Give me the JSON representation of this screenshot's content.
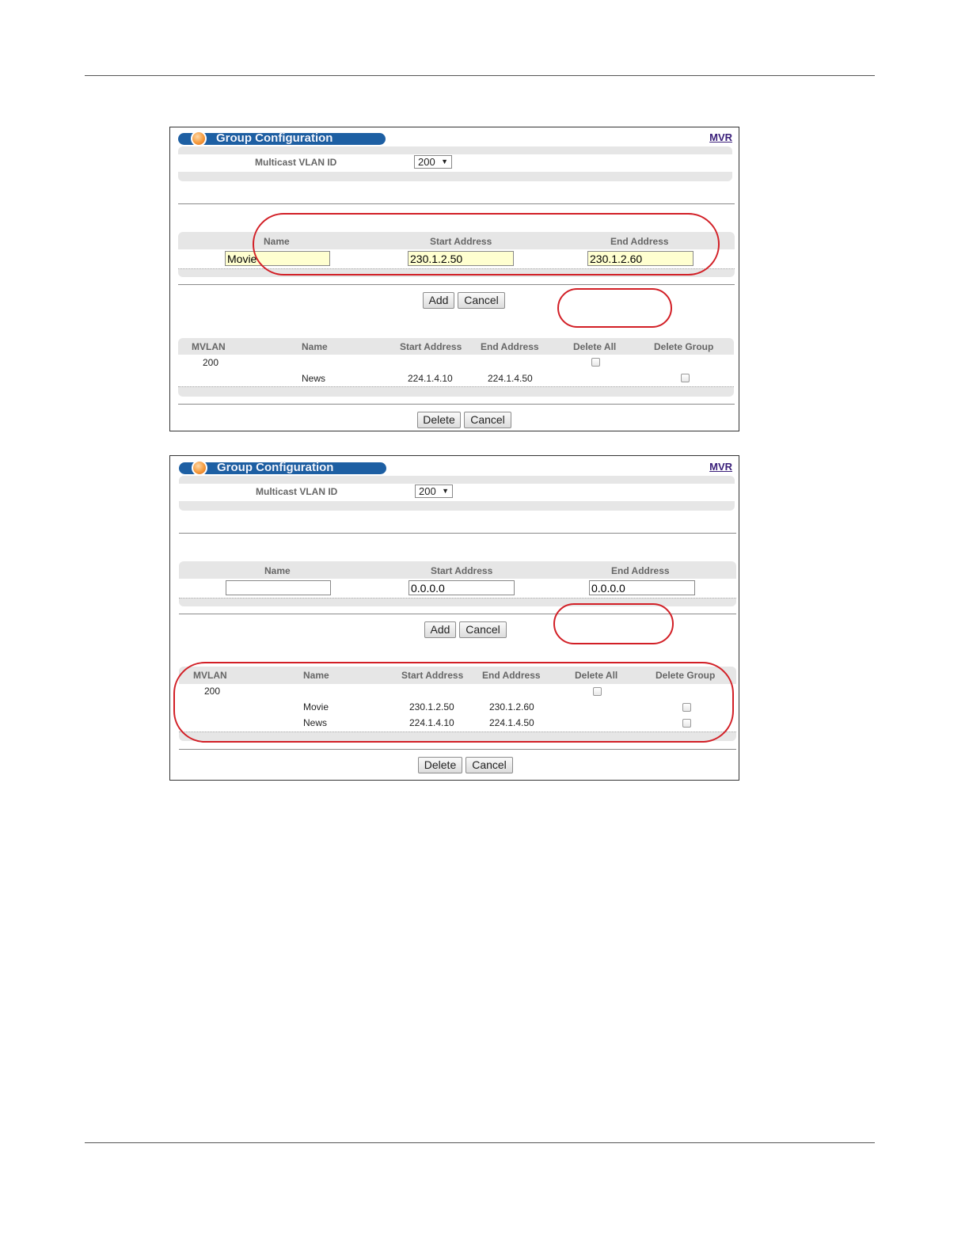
{
  "panels": [
    {
      "title": "Group Configuration",
      "link": "MVR",
      "vlan_label": "Multicast VLAN ID",
      "vlan_value": "200",
      "form_headers": {
        "name": "Name",
        "start": "Start Address",
        "end": "End Address"
      },
      "form_values": {
        "name": "Movie",
        "start": "230.1.2.50",
        "end": "230.1.2.60"
      },
      "add_label": "Add",
      "cancel_label": "Cancel",
      "table_headers": [
        "MVLAN",
        "Name",
        "Start Address",
        "End Address",
        "Delete All",
        "Delete Group"
      ],
      "mvlan_value": "200",
      "rows": [
        {
          "name": "News",
          "start": "224.1.4.10",
          "end": "224.1.4.50"
        }
      ],
      "delete_label": "Delete",
      "cancel2_label": "Cancel"
    },
    {
      "title": "Group Configuration",
      "link": "MVR",
      "vlan_label": "Multicast VLAN ID",
      "vlan_value": "200",
      "form_headers": {
        "name": "Name",
        "start": "Start Address",
        "end": "End Address"
      },
      "form_values": {
        "name": "",
        "start": "0.0.0.0",
        "end": "0.0.0.0"
      },
      "add_label": "Add",
      "cancel_label": "Cancel",
      "table_headers": [
        "MVLAN",
        "Name",
        "Start Address",
        "End Address",
        "Delete All",
        "Delete Group"
      ],
      "mvlan_value": "200",
      "rows": [
        {
          "name": "Movie",
          "start": "230.1.2.50",
          "end": "230.1.2.60"
        },
        {
          "name": "News",
          "start": "224.1.4.10",
          "end": "224.1.4.50"
        }
      ],
      "delete_label": "Delete",
      "cancel2_label": "Cancel"
    }
  ],
  "colors": {
    "title_bar": "#1d5fa3",
    "highlight": "#d21f26",
    "input_filled": "#ffffd0"
  }
}
